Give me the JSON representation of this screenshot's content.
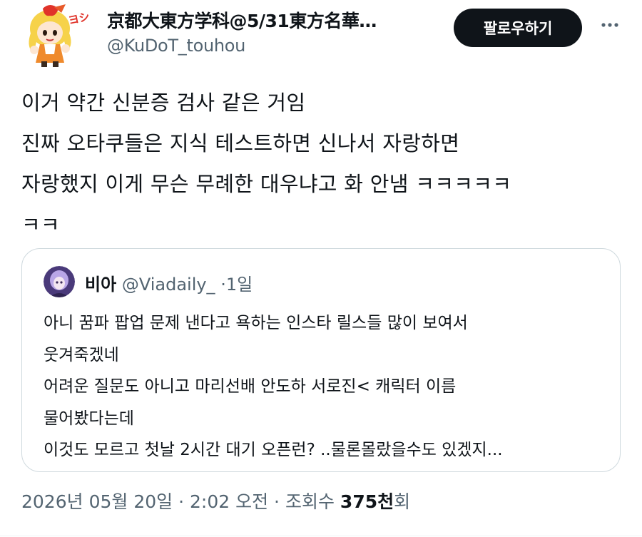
{
  "author": {
    "name": "京都大東方学科@5/31東方名華…",
    "handle": "@KuDoT_touhou",
    "avatar_text": "ヨシ!"
  },
  "follow_button": {
    "label": "팔로우하기"
  },
  "more_icon": "more-horizontal-icon",
  "tweet": {
    "lines": [
      "이거 약간 신분증 검사 같은 거임",
      "진짜 오타쿠들은 지식 테스트하면 신나서 자랑하면",
      "자랑했지 이게 무슨 무례한 대우냐고 화 안냄 ㅋㅋㅋㅋㅋ",
      "ㅋㅋ"
    ]
  },
  "quote": {
    "name": "비아",
    "handle": "@Viadaily_",
    "separator": "·",
    "time": "1일",
    "lines": [
      "아니 꿈파 팝업 문제 낸다고 욕하는 인스타 릴스들 많이 보여서",
      "웃겨죽겠네",
      "어려운 질문도 아니고 마리선배 안도하 서로진< 캐릭터 이름",
      "물어봤다는데",
      "이것도 모르고 첫날 2시간 대기 오픈런? ..물론몰랐을수도 있겠지..."
    ]
  },
  "meta": {
    "date": "2026년 05월 20일",
    "separator1": "·",
    "time": "2:02 오전",
    "separator2": "·",
    "views_label": "조회수",
    "views_count": "375천",
    "views_suffix": "회"
  },
  "colors": {
    "text": "#0f1419",
    "secondary": "#536471",
    "border": "#cfd9de",
    "follow_bg": "#0f1419"
  }
}
